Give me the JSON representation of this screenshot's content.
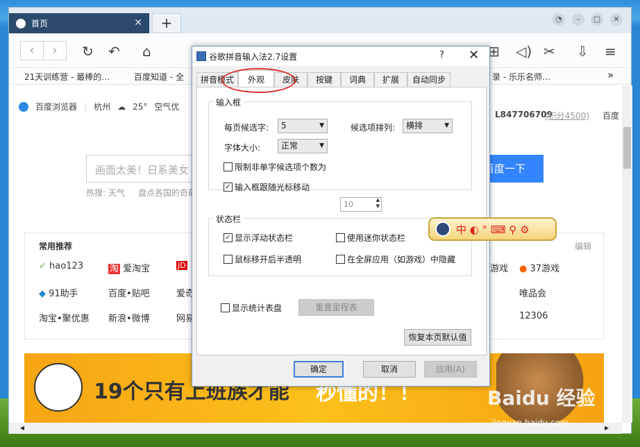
{
  "browser": {
    "tab_title": "首页",
    "tab_close": "✕",
    "newtab": "+",
    "bookmarks": [
      "21天训练营 - 最棒的…",
      "百度知道 - 全",
      "录 - 乐乐名师…"
    ],
    "bookmarks_more": "»"
  },
  "page": {
    "brand": "百度浏览器",
    "city": "杭州",
    "temp": "25°",
    "air": "空气优",
    "account": "L847706709",
    "points": "(积分4500)",
    "homepage": "百度",
    "search_placeholder": "画面太美！日系美女",
    "search_button": "百度一下",
    "hot": "热搜: 天气",
    "hot2": "盘点各国的奇葩",
    "common_title": "常用推荐",
    "edit": "编辑",
    "items": [
      "hao123",
      "爱淘宝",
      "JD",
      "91助手",
      "百度•贴吧",
      "爱奇",
      "淘宝•聚优惠",
      "新浪•微博",
      "网易",
      "游戏",
      "37游戏",
      "唯品会",
      "12306"
    ],
    "banner": "19个只有上班族才能",
    "banner2": "秒懂的！！"
  },
  "dialog": {
    "title": "谷歌拼音输入法2.7设置",
    "help": "?",
    "close": "✕",
    "tabs": [
      "拼音模式",
      "外观",
      "皮肤",
      "按键",
      "词典",
      "扩展",
      "自动同步"
    ],
    "group1": "输入框",
    "per_page_label": "每页候选字:",
    "per_page_value": "5",
    "arrange_label": "候选项排列:",
    "arrange_value": "横排",
    "font_label": "字体大小:",
    "font_value": "正常",
    "limit_label": "限制非单字候选项个数为",
    "limit_value": "10",
    "follow_label": "输入框跟随光标移动",
    "group2": "状态栏",
    "show_float": "显示浮动状态栏",
    "use_mini": "使用迷你状态栏",
    "mouse_transparent": "鼠标移开后半透明",
    "fullscreen_hide": "在全屏应用（如游戏）中隐藏",
    "show_stats": "显示统计表盘",
    "reset_mileage": "重置里程表",
    "restore_defaults": "恢复本页默认值",
    "ok": "确定",
    "cancel": "取消",
    "apply": "应用(A)",
    "statusbar_glyphs": "中 ◐ ° ⌨ ⚲ ⚙"
  },
  "watermark": {
    "main": "Baidu 经验",
    "sub": "jingyan.baidu.com"
  }
}
